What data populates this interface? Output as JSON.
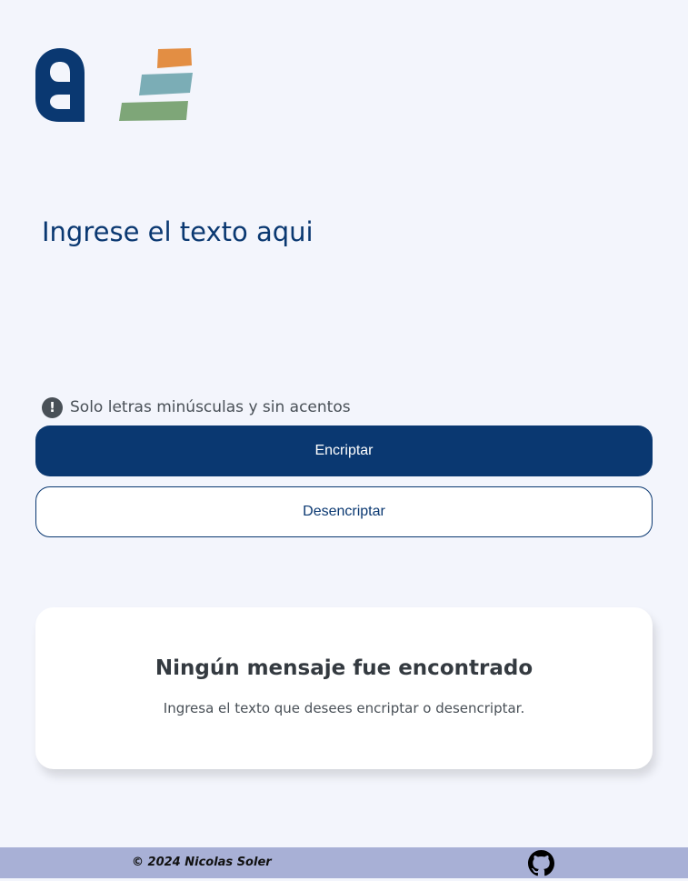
{
  "app": {
    "logo_name": "alura-logo"
  },
  "input": {
    "placeholder": "Ingrese el texto aqui",
    "value": ""
  },
  "hint": {
    "icon": "exclamation-circle-icon",
    "text": "Solo letras minúsculas y sin acentos"
  },
  "buttons": {
    "encrypt_label": "Encriptar",
    "decrypt_label": "Desencriptar"
  },
  "result": {
    "title": "Ningún mensaje fue encontrado",
    "text": "Ingresa el texto que desees encriptar o desencriptar."
  },
  "footer": {
    "copyright": "© 2024 Nicolas Soler",
    "github_icon": "github-icon"
  },
  "colors": {
    "primary": "#0A3871",
    "background": "#F3F5FC",
    "footer_bg": "#A8B0D6",
    "text_gray": "#495057",
    "heading": "#343A40"
  }
}
